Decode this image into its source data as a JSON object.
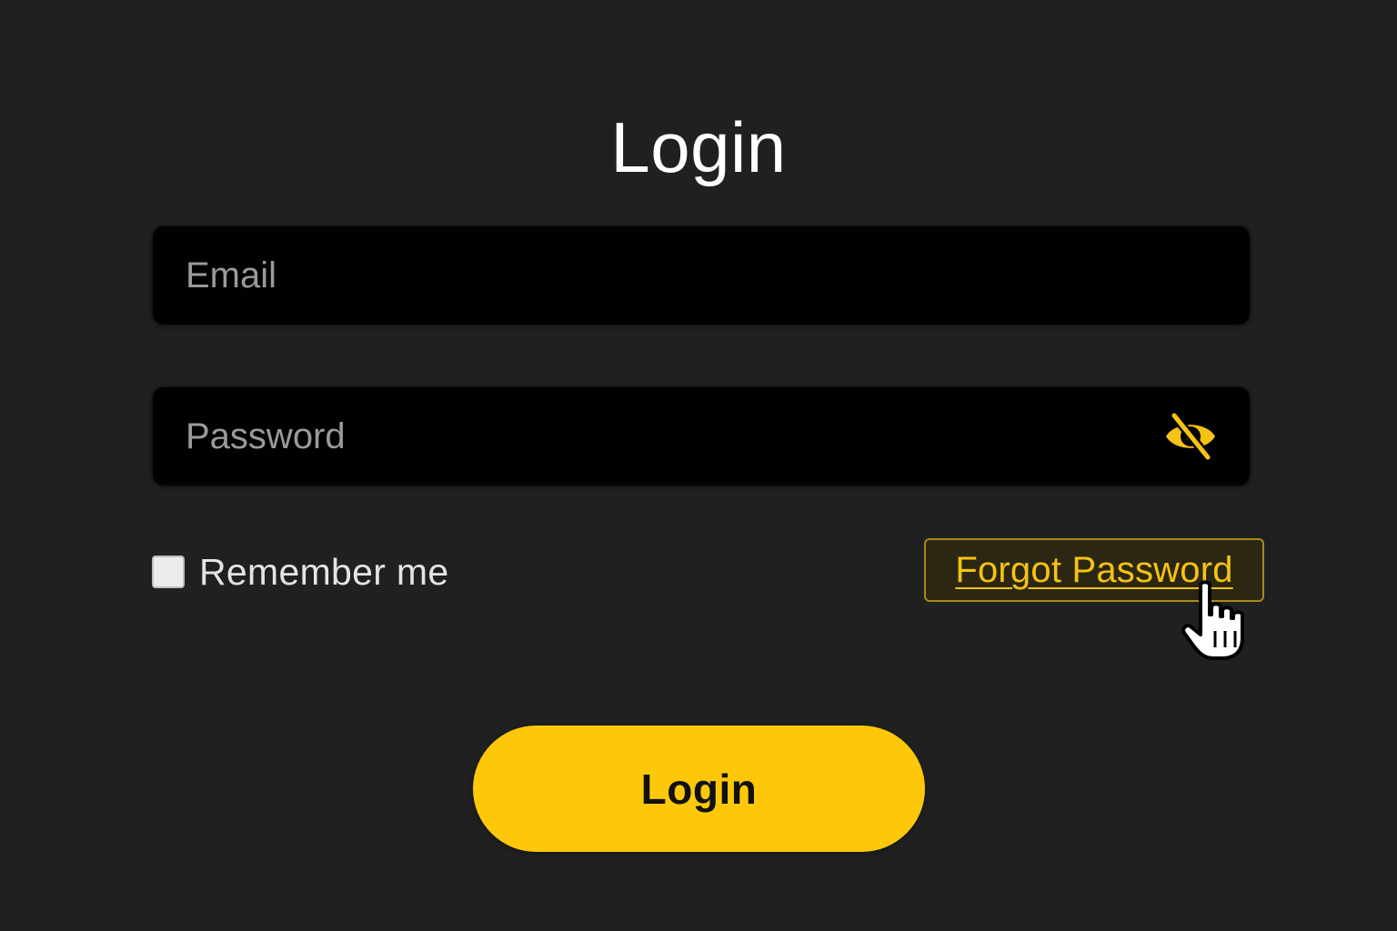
{
  "header": {
    "title": "Login"
  },
  "form": {
    "email": {
      "placeholder": "Email",
      "value": ""
    },
    "password": {
      "placeholder": "Password",
      "value": "",
      "toggle_icon": "eye-slash-icon"
    },
    "remember": {
      "label": "Remember me",
      "checked": false
    },
    "forgot_password": {
      "label": "Forgot Password"
    },
    "submit": {
      "label": "Login"
    }
  },
  "colors": {
    "background": "#202020",
    "field_background": "#010101",
    "accent": "#fdc80a",
    "link": "#f5c312"
  },
  "cursor": {
    "icon": "hand-pointer-icon"
  }
}
